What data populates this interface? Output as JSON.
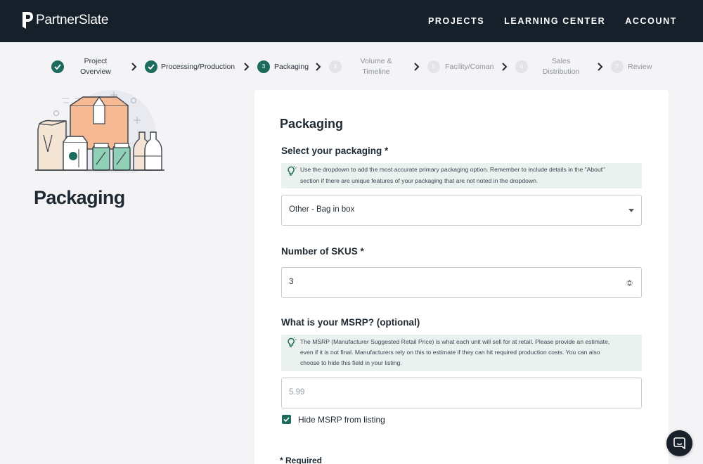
{
  "app": {
    "logo_text": "PartnerSlate"
  },
  "nav": {
    "projects": "PROJECTS",
    "learning_center": "LEARNING CENTER",
    "account": "ACCOUNT"
  },
  "stepper": {
    "steps": [
      {
        "label_line1": "Project",
        "label_line2": "Overview",
        "status": "complete"
      },
      {
        "label_line1": "Processing/Production",
        "label_line2": "",
        "status": "complete"
      },
      {
        "number": "3",
        "label_line1": "Packaging",
        "label_line2": "",
        "status": "current"
      },
      {
        "number": "4",
        "label_line1": "Volume &",
        "label_line2": "Timeline",
        "status": "upcoming"
      },
      {
        "number": "5",
        "label_line1": "Facility/Coman",
        "label_line2": "",
        "status": "upcoming"
      },
      {
        "number": "6",
        "label_line1": "Sales",
        "label_line2": "Distribution",
        "status": "upcoming"
      },
      {
        "number": "7",
        "label_line1": "Review",
        "label_line2": "",
        "status": "upcoming"
      }
    ]
  },
  "page": {
    "title": "Packaging"
  },
  "form": {
    "card_title": "Packaging",
    "packaging": {
      "label": "Select your packaging *",
      "hint_line1": "Use the dropdown to add the most accurate primary packaging option. Remember to include details in the \"About\"",
      "hint_line2": "section if there are unique features of your packaging that are not noted in the dropdown.",
      "selected": "Other - Bag in box"
    },
    "skus": {
      "label": "Number of SKUS *",
      "value": "3"
    },
    "msrp": {
      "label": "What is your MSRP? (optional)",
      "hint_line1": "The MSRP (Manufacturer Suggested Retail Price) is what each unit will sell for at retail. Please provide an estimate,",
      "hint_line2": "even if it is not final. Manufacturers rely on this to estimate if they can hit required production costs. You can also",
      "hint_line3": "choose to hide this field in your listing.",
      "placeholder": "5.99"
    },
    "hide_msrp": {
      "label": "Hide MSRP from listing",
      "checked": true
    },
    "required_note": "* Required"
  },
  "colors": {
    "brand_dark": "#16202b",
    "accent_green": "#1d6b5c",
    "hint_bg": "#eaf1ef",
    "page_bg": "#f4f4f6"
  },
  "icons": {
    "logo": "partnerslate-logo-icon",
    "step_complete": "check-circle-icon",
    "step_arrow": "chevron-right-icon",
    "hint": "lightbulb-icon",
    "dropdown": "caret-down-icon",
    "number_spinner": "spinner-arrows-icon",
    "checkbox": "checkmark-icon",
    "chat": "chat-bubble-icon"
  }
}
